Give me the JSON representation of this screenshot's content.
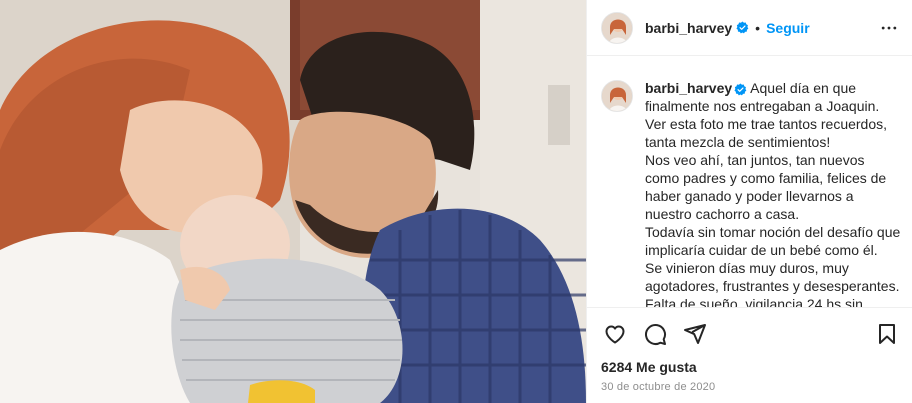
{
  "post": {
    "photo_alt": "Foto de la publicación",
    "header": {
      "username": "barbi_harvey",
      "separator": "•",
      "follow_label": "Seguir"
    },
    "caption": {
      "username": "barbi_harvey",
      "lines": [
        "Aquel día en que",
        "finalmente nos entregaban a Joaquin.",
        "Ver esta foto me trae tantos recuerdos,",
        "tanta mezcla de sentimientos!",
        "Nos veo ahí, tan juntos, tan nuevos",
        "como padres y como familia, felices de",
        "haber ganado y poder llevarnos a",
        "nuestro cachorro a casa.",
        "Todavía sin tomar noción del desafío que",
        "implicaría cuidar de un bebé como él.",
        "Se vinieron días muy duros, muy",
        "agotadores, frustrantes y desesperantes.",
        "Falta de sueño, vigilancia 24 hs sin"
      ]
    },
    "likes": "6284 Me gusta",
    "date": "30 de octubre de 2020",
    "icons": {
      "verified": "verified-badge-icon",
      "more": "more-options-icon",
      "like": "heart-icon",
      "comment": "comment-icon",
      "share": "share-icon",
      "save": "bookmark-icon"
    },
    "colors": {
      "accent": "#0095f6",
      "text": "#262626",
      "muted": "#8e8e8e",
      "border": "#efefef"
    }
  }
}
